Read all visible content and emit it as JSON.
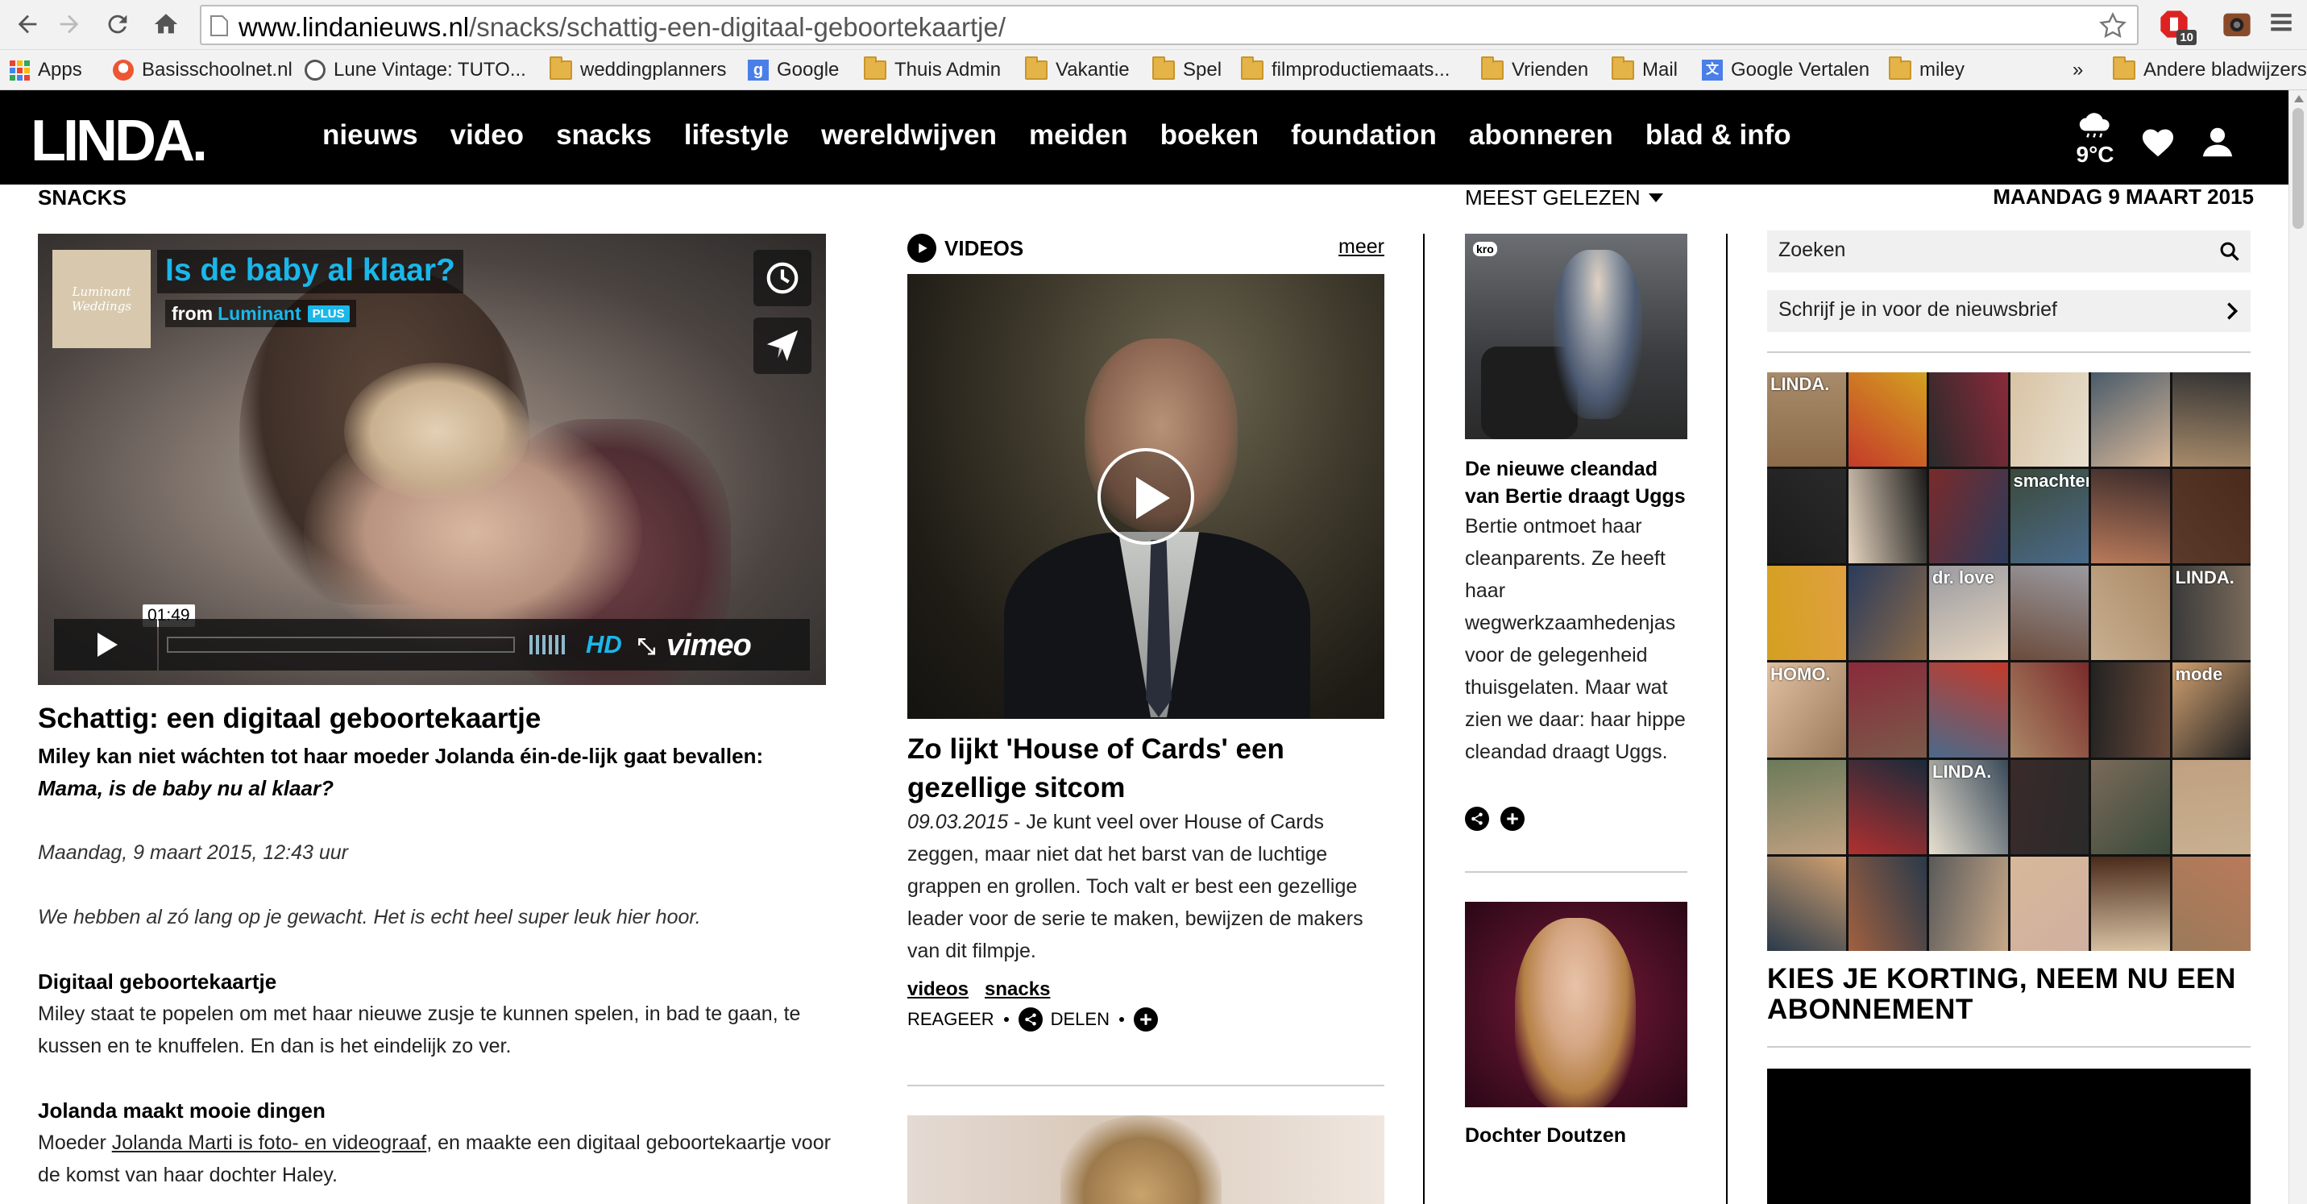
{
  "browser": {
    "url_host": "www.lindanieuws.nl",
    "url_path": "/snacks/schattig-een-digitaal-geboortekaartje/",
    "extension_badge": "10",
    "bookmarks": [
      {
        "label": "Apps",
        "icon": "apps-grid-icon"
      },
      {
        "label": "Basisschoolnet.nl",
        "icon": "basisschoolnet-favicon"
      },
      {
        "label": "Lune Vintage: TUTO...",
        "icon": "lune-vintage-favicon"
      },
      {
        "label": "weddingplanners",
        "icon": "folder-icon"
      },
      {
        "label": "Google",
        "icon": "google-favicon"
      },
      {
        "label": "Thuis Admin",
        "icon": "folder-icon"
      },
      {
        "label": "Vakantie",
        "icon": "folder-icon"
      },
      {
        "label": "Spel",
        "icon": "folder-icon"
      },
      {
        "label": "filmproductiemaats...",
        "icon": "folder-icon"
      },
      {
        "label": "Vrienden",
        "icon": "folder-icon"
      },
      {
        "label": "Mail",
        "icon": "folder-icon"
      },
      {
        "label": "Google Vertalen",
        "icon": "google-translate-favicon"
      },
      {
        "label": "miley",
        "icon": "folder-icon"
      }
    ],
    "overflow_label": "»",
    "other_bookmarks": "Andere bladwijzers"
  },
  "header": {
    "logo": "LINDA.",
    "nav": [
      "nieuws",
      "video",
      "snacks",
      "lifestyle",
      "wereldwijven",
      "meiden",
      "boeken",
      "foundation",
      "abonneren",
      "blad & info"
    ],
    "weather_temp": "9°C"
  },
  "subbar": {
    "section": "SNACKS",
    "meest_gelezen": "MEEST GELEZEN",
    "date": "MAANDAG 9 MAART 2015"
  },
  "video_main": {
    "badge_text": "Luminant Weddings",
    "title": "Is de baby al klaar?",
    "from_label": "from",
    "owner": "Luminant",
    "plus": "PLUS",
    "time": "01:49",
    "hd": "HD",
    "fullscreen": "⤡",
    "logo": "vimeo"
  },
  "article": {
    "title": "Schattig: een digitaal geboortekaartje",
    "lead": "Miley kan niet wáchten tot haar moeder Jolanda éin-de-lijk gaat bevallen:",
    "lead_quote": "Mama, is de baby nu al klaar?",
    "meta": "Maandag, 9 maart 2015, 12:43 uur",
    "intro": "We hebben al zó lang op je gewacht. Het is echt heel super leuk hier hoor.",
    "h1": "Digitaal geboortekaartje",
    "p1": "Miley staat te popelen om met haar nieuwe zusje te kunnen spelen, in bad te gaan, te kussen en te knuffelen. En dan is het eindelijk zo ver.",
    "h2": "Jolanda maakt mooie dingen",
    "p2_pre": "Moeder ",
    "p2_link": "Jolanda Marti is foto- en videograaf",
    "p2_post": ", en maakte een digitaal geboortekaartje voor de komst van haar dochter Haley."
  },
  "videos": {
    "label": "VIDEOS",
    "more": "meer",
    "title": "Zo lijkt 'House of Cards' een gezellige sitcom",
    "date": "09.03.2015",
    "text": " - Je kunt veel over House of Cards zeggen, maar niet dat het barst van de luchtige grappen en grollen. Toch valt er best een gezellige leader voor de serie te maken, bewijzen de makers van dit filmpje.",
    "tags": [
      "videos",
      "snacks"
    ],
    "react": "REAGEER",
    "share": "DELEN"
  },
  "meest_gelezen": {
    "item1_channel": "kro",
    "item1_title": "De nieuwe cleandad van Bertie draagt Uggs",
    "item1_text": "Bertie ontmoet haar cleanparents. Ze heeft haar wegwerkzaamhedenjas voor de gelegenheid thuisgelaten. Maar wat zien we daar: haar hippe cleandad draagt Uggs.",
    "item2_title": "Dochter Doutzen"
  },
  "right": {
    "search_placeholder": "Zoeken",
    "newsletter": "Schrijf je in voor de nieuwsbrief",
    "covers": [
      "LINDA.",
      "",
      "",
      "",
      "",
      "",
      "",
      "",
      "",
      "smachten",
      "",
      "",
      "",
      "",
      "dr. love",
      "",
      "",
      "LINDA.",
      "HOMO.",
      "",
      "",
      "",
      "",
      "mode",
      "",
      "",
      "LINDA.",
      "",
      "",
      "",
      "",
      "",
      "",
      "",
      "",
      "",
      "",
      "",
      "",
      "",
      "",
      "",
      "",
      "",
      "",
      "",
      "",
      ""
    ],
    "cta": "KIES JE KORTING, NEEM NU EEN ABONNEMENT"
  },
  "colors": {
    "vimeo_blue": "#1ab7ea",
    "header_black": "#000000"
  }
}
